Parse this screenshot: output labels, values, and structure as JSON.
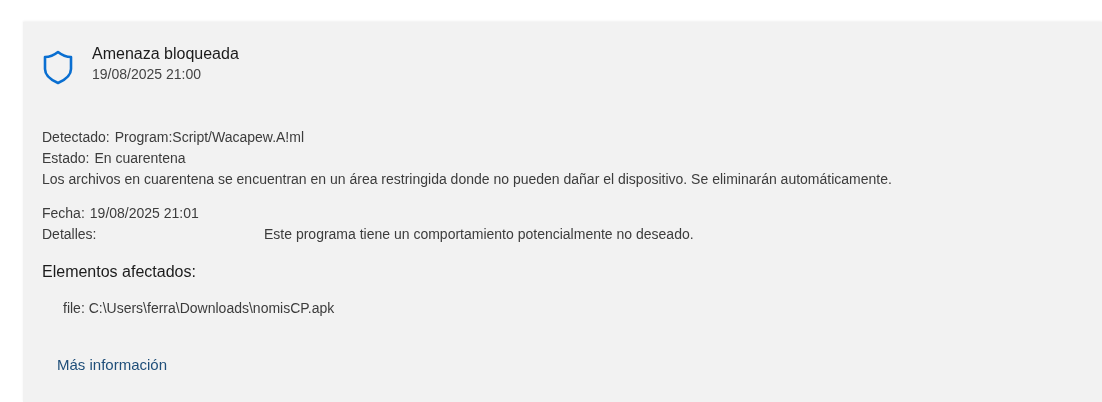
{
  "alert": {
    "title": "Amenaza bloqueada",
    "timestamp": "19/08/2025 21:00"
  },
  "detail_groups": [
    [
      {
        "kind": "field",
        "label": "Detectado:",
        "value": "Program:Script/Wacapew.A!ml"
      },
      {
        "kind": "field",
        "label": "Estado:",
        "value": "En cuarentena"
      },
      {
        "kind": "note",
        "text": "Los archivos en cuarentena se encuentran en un área restringida donde no pueden dañar el dispositivo. Se eliminarán automáticamente."
      }
    ],
    [
      {
        "kind": "field",
        "label": "Fecha:",
        "value": "19/08/2025 21:01"
      },
      {
        "kind": "column",
        "label": "Detalles:",
        "value": "Este programa tiene un comportamiento potencialmente no deseado."
      }
    ]
  ],
  "affected": {
    "heading": "Elementos afectados:",
    "items": [
      "file: C:\\Users\\ferra\\Downloads\\nomisCP.apk"
    ]
  },
  "link": "Más información"
}
